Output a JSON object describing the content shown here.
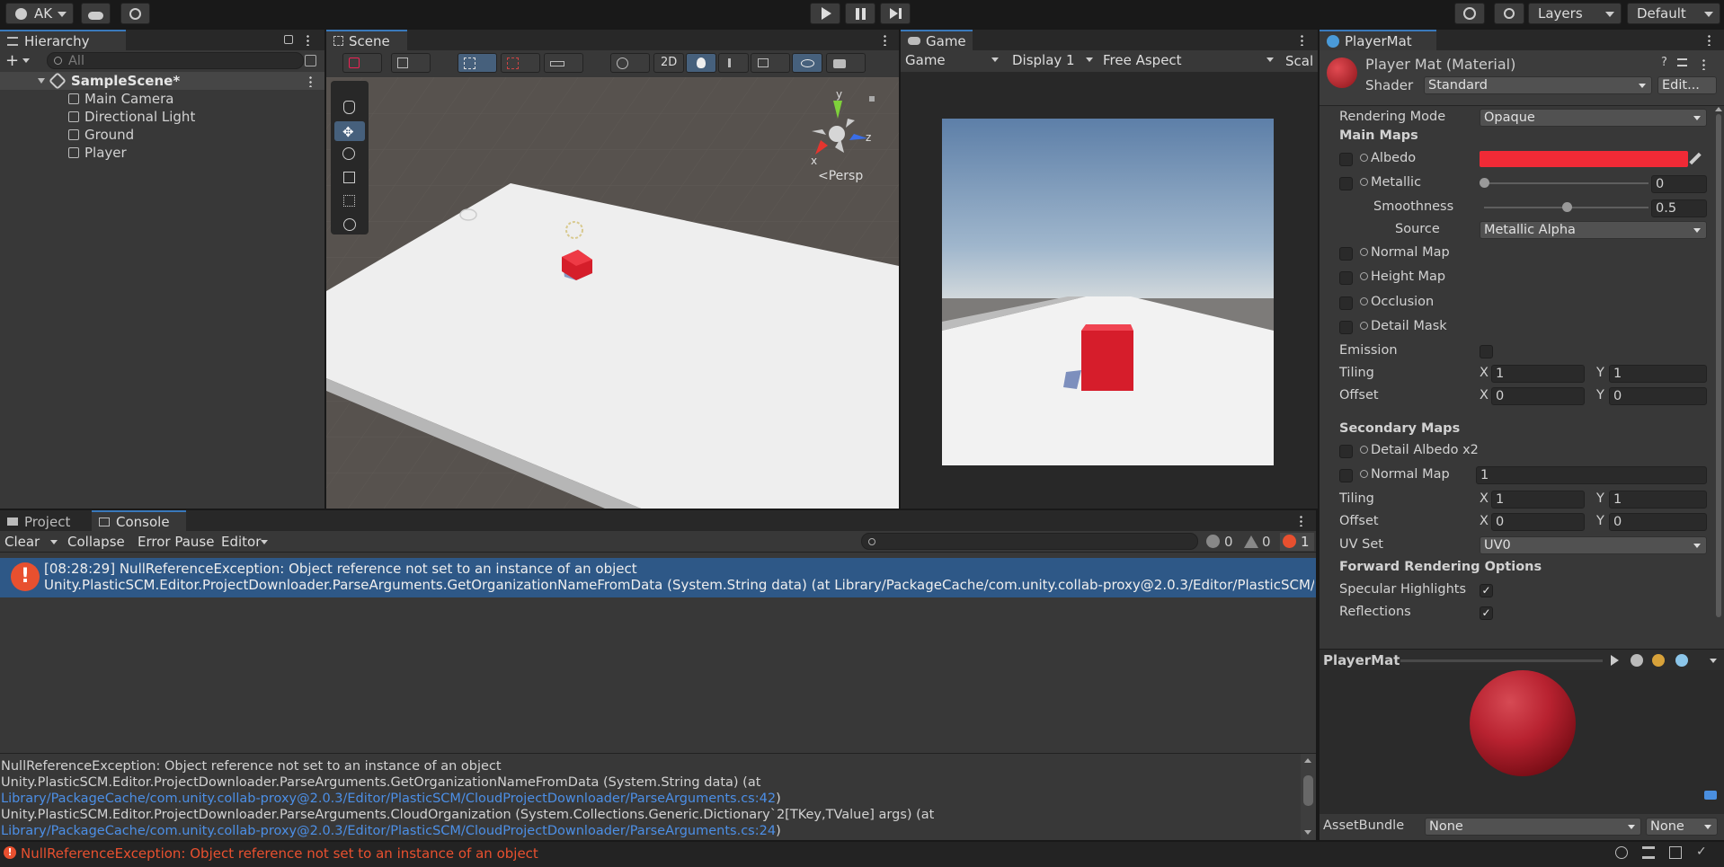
{
  "toolbar": {
    "account": "AK",
    "layers": "Layers",
    "layout": "Default"
  },
  "hierarchy": {
    "tab": "Hierarchy",
    "search_placeholder": "All",
    "scene": "SampleScene*",
    "items": [
      "Main Camera",
      "Directional Light",
      "Ground",
      "Player"
    ]
  },
  "scene": {
    "tab": "Scene",
    "mode_2d": "2D",
    "persp": "<Persp",
    "axis_x": "x",
    "axis_y": "y",
    "axis_z": "z"
  },
  "game": {
    "tab": "Game",
    "game_dropdown": "Game",
    "display": "Display 1",
    "aspect": "Free Aspect",
    "scale": "Scal"
  },
  "console": {
    "tab_project": "Project",
    "tab_console": "Console",
    "clear": "Clear",
    "collapse": "Collapse",
    "error_pause": "Error Pause",
    "editor": "Editor",
    "count_log": "0",
    "count_warn": "0",
    "count_error": "1",
    "entry_line1": "[08:28:29] NullReferenceException: Object reference not set to an instance of an object",
    "entry_line2": "Unity.PlasticSCM.Editor.ProjectDownloader.ParseArguments.GetOrganizationNameFromData (System.String data) (at Library/PackageCache/com.unity.collab-proxy@2.0.3/Editor/PlasticSCM/Cloud",
    "detail": [
      {
        "text": "NullReferenceException: Object reference not set to an instance of an object",
        "link": false
      },
      {
        "text": "Unity.PlasticSCM.Editor.ProjectDownloader.ParseArguments.GetOrganizationNameFromData (System.String data) (at",
        "link": false
      },
      {
        "text": "Library/PackageCache/com.unity.collab-proxy@2.0.3/Editor/PlasticSCM/CloudProjectDownloader/ParseArguments.cs:42",
        "link": true,
        "suffix": ")"
      },
      {
        "text": "Unity.PlasticSCM.Editor.ProjectDownloader.ParseArguments.CloudOrganization (System.Collections.Generic.Dictionary`2[TKey,TValue] args) (at",
        "link": false
      },
      {
        "text": "Library/PackageCache/com.unity.collab-proxy@2.0.3/Editor/PlasticSCM/CloudProjectDownloader/ParseArguments.cs:24",
        "link": true,
        "suffix": ")"
      }
    ],
    "status": "NullReferenceException: Object reference not set to an instance of an object"
  },
  "inspector": {
    "tab": "PlayerMat",
    "title": "Player Mat (Material)",
    "shader_label": "Shader",
    "shader_value": "Standard",
    "edit_button": "Edit...",
    "rendering_mode_label": "Rendering Mode",
    "rendering_mode_value": "Opaque",
    "main_maps": "Main Maps",
    "albedo": "Albedo",
    "albedo_color": "#f02a36",
    "metallic": "Metallic",
    "metallic_value": "0",
    "metallic_level": 0,
    "smoothness": "Smoothness",
    "smoothness_value": "0.5",
    "smoothness_level": 0.5,
    "source_label": "Source",
    "source_value": "Metallic Alpha",
    "normal_map": "Normal Map",
    "height_map": "Height Map",
    "occlusion": "Occlusion",
    "detail_mask": "Detail Mask",
    "emission": "Emission",
    "tiling": "Tiling",
    "offset": "Offset",
    "x": "X",
    "y": "Y",
    "tiling_x": "1",
    "tiling_y": "1",
    "offset_x": "0",
    "offset_y": "0",
    "secondary_maps": "Secondary Maps",
    "detail_albedo": "Detail Albedo x2",
    "sec_normal_map": "Normal Map",
    "sec_normal_value": "1",
    "sec_tiling_x": "1",
    "sec_tiling_y": "1",
    "sec_offset_x": "0",
    "sec_offset_y": "0",
    "uv_set_label": "UV Set",
    "uv_set_value": "UV0",
    "forward_options": "Forward Rendering Options",
    "specular": "Specular Highlights",
    "reflections": "Reflections",
    "preview_title": "PlayerMat",
    "assetbundle_label": "AssetBundle",
    "assetbundle_value": "None",
    "assetbundle_variant": "None"
  }
}
